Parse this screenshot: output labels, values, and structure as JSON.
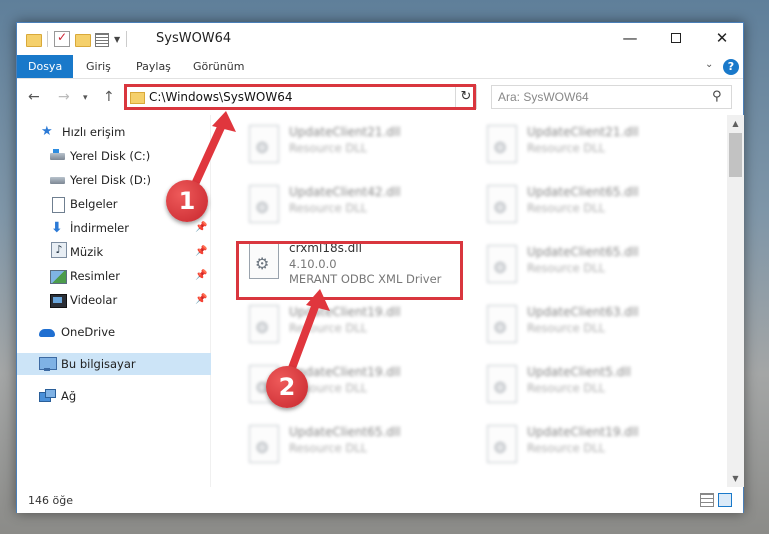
{
  "window": {
    "title": "SysWOW64",
    "controls": {
      "minimize": "—",
      "maximize": "",
      "close": "✕"
    }
  },
  "ribbon": {
    "tabs": [
      "Dosya",
      "Giriş",
      "Paylaş",
      "Görünüm"
    ],
    "active_tab": "Dosya",
    "expand_symbol": "⌄",
    "help_symbol": "?"
  },
  "address": {
    "path": "C:\\Windows\\SysWOW64",
    "refresh_symbol": "↻",
    "search_placeholder": "Ara: SysWOW64"
  },
  "sidebar": {
    "items": [
      {
        "label": "Hızlı erişim",
        "icon": "star-icon"
      },
      {
        "label": "Yerel Disk (C:)",
        "icon": "disk-icon"
      },
      {
        "label": "Yerel Disk (D:)",
        "icon": "disk-icon"
      },
      {
        "label": "Belgeler",
        "icon": "document-icon"
      },
      {
        "label": "İndirmeler",
        "icon": "download-icon",
        "pinned": true
      },
      {
        "label": "Müzik",
        "icon": "music-icon",
        "pinned": true
      },
      {
        "label": "Resimler",
        "icon": "pictures-icon",
        "pinned": true
      },
      {
        "label": "Videolar",
        "icon": "videos-icon",
        "pinned": true
      },
      {
        "label": "OneDrive",
        "icon": "cloud-icon"
      },
      {
        "label": "Bu bilgisayar",
        "icon": "computer-icon",
        "selected": true
      },
      {
        "label": "Ağ",
        "icon": "network-icon"
      }
    ],
    "pin_symbol": "📌"
  },
  "files": {
    "highlighted": {
      "name": "crxml18s.dll",
      "version": "4.10.0.0",
      "description": "MERANT ODBC XML Driver"
    },
    "blurred": [
      {
        "name": "UpdateClient21.dll",
        "type": "Resource DLL"
      },
      {
        "name": "UpdateClient21.dll",
        "type": "Resource DLL"
      },
      {
        "name": "UpdateClient42.dll",
        "type": "Resource DLL"
      },
      {
        "name": "UpdateClient65.dll",
        "type": "Resource DLL"
      },
      {
        "name": "UpdateClient65.dll",
        "type": "Resource DLL"
      },
      {
        "name": "UpdateClient19.dll",
        "type": "Resource DLL"
      },
      {
        "name": "UpdateClient63.dll",
        "type": "Resource DLL"
      },
      {
        "name": "UpdateClient19.dll",
        "type": "Resource DLL"
      },
      {
        "name": "UpdateClient5.dll",
        "type": "Resource DLL"
      },
      {
        "name": "UpdateClient65.dll",
        "type": "Resource DLL"
      },
      {
        "name": "UpdateClient19.dll",
        "type": "Resource DLL"
      }
    ]
  },
  "status": {
    "item_count": "146 öğe"
  },
  "callouts": {
    "one": "1",
    "two": "2"
  },
  "colors": {
    "accent": "#1979ca",
    "highlight": "#d9363e",
    "selected_bg": "#cce4f7"
  }
}
